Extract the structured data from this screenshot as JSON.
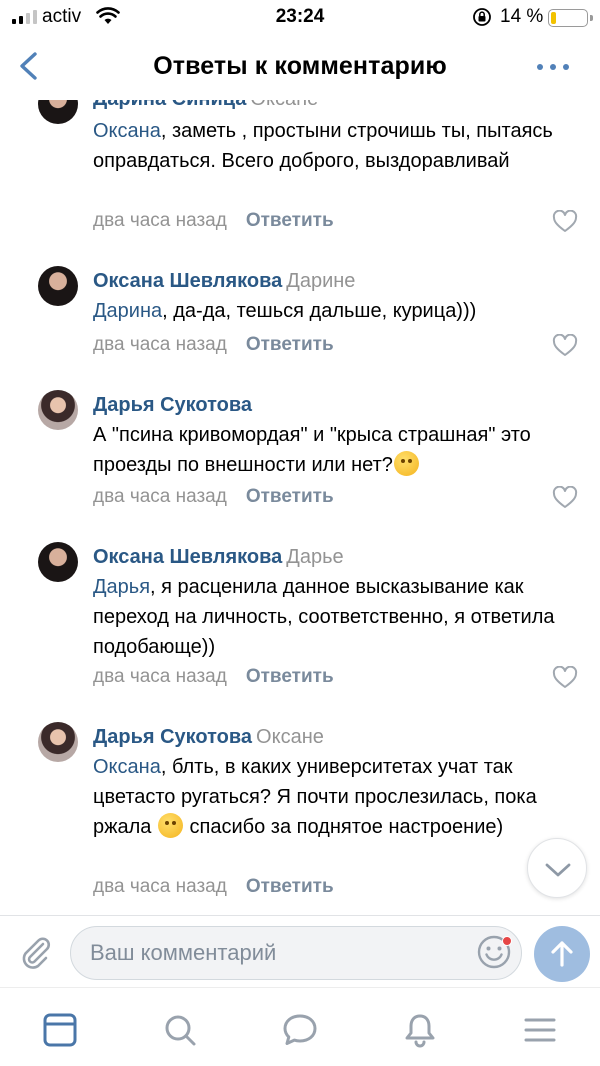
{
  "status_bar": {
    "carrier": "activ",
    "time": "23:24",
    "battery_percent": "14 %",
    "battery_level": 0.14,
    "signal_bars_active": 2,
    "signal_bars_total": 4
  },
  "header": {
    "title": "Ответы к комментарию",
    "back_icon": "chevron-left-icon",
    "menu_icon": "more-dots-icon"
  },
  "comments": [
    {
      "author": "Дарина Синица",
      "addressee": "Оксане",
      "mention": "Оксана",
      "text": ", заметь , простыни строчишь ты, пытаясь оправдаться. Всего доброго, выздоравливай",
      "time": "два часа назад",
      "reply_label": "Ответить"
    },
    {
      "author": "Оксана Шевлякова",
      "addressee": "Дарине",
      "mention": "Дарина",
      "text": ", да-да, тешься дальше, курица)))",
      "time": "два часа назад",
      "reply_label": "Ответить"
    },
    {
      "author": "Дарья Сукотова",
      "text": "А \"псина кривомордая\" и \"крыса страшная\" это проезды по внешности или нет?",
      "emoji": "thinking-face-emoji",
      "time": "два часа назад",
      "reply_label": "Ответить"
    },
    {
      "author": "Оксана Шевлякова",
      "addressee": "Дарье",
      "mention": "Дарья",
      "text": ", я расценила данное высказывание как переход на личность, соответственно, я ответила подобающе))",
      "time": "два часа назад",
      "reply_label": "Ответить"
    },
    {
      "author": "Дарья Сукотова",
      "addressee": "Оксане",
      "mention": "Оксана",
      "text": ", блть, в каких университетах учат так цветасто ругаться? Я почти прослезилась, пока ржала",
      "emoji": "laughing-crying-emoji",
      "text_after_emoji": " спасибо за поднятое настроение)",
      "time": "два часа назад",
      "reply_label": "Ответить"
    }
  ],
  "composer": {
    "placeholder": "Ваш комментарий"
  },
  "tabbar": {
    "items": [
      "news-feed-icon",
      "search-icon",
      "messages-icon",
      "notifications-icon",
      "menu-icon"
    ]
  },
  "colors": {
    "accent": "#5181b8",
    "name_link": "#2a5885",
    "meta_text": "#939393",
    "send_button": "#9fbde0",
    "notification_dot": "#e64646",
    "battery_low": "#f2c200"
  }
}
